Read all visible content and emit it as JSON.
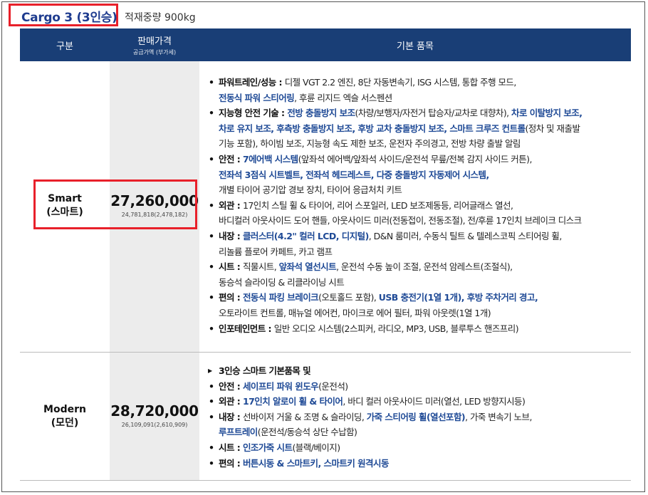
{
  "title": {
    "label": "Cargo 3 (3인승)",
    "payload": "적재중량 900kg"
  },
  "header": {
    "gubun": "구분",
    "price": "판매가격",
    "price_sub": "공급가액 (부가세)",
    "basic": "기본 품목"
  },
  "trims": [
    {
      "name": "Smart",
      "name_ko": "(스마트)",
      "price": "27,260,000",
      "price_sub": "24,781,818(2,478,182)"
    },
    {
      "name": "Modern",
      "name_ko": "(모던)",
      "price": "28,720,000",
      "price_sub": "26,109,091(2,610,909)"
    }
  ],
  "smart_features": [
    {
      "cat": "파워트레인/성능 : ",
      "lines": [
        [
          {
            "t": "디젤 VGT 2.2 엔진, 8단 자동변속기, ISG 시스템, 통합 주행 모드,"
          }
        ],
        [
          {
            "t": "전동식 파워 스티어링",
            "h": true
          },
          {
            "t": ", 후륜 리지드 엑슬 서스펜션"
          }
        ]
      ]
    },
    {
      "cat": "지능형 안전 기술 : ",
      "lines": [
        [
          {
            "t": "전방 충돌방지 보조",
            "h": true
          },
          {
            "t": "(차량/보행자/자전거 탑승자/교차로 대향차), "
          },
          {
            "t": "차로 이탈방지 보조,",
            "h": true
          }
        ],
        [
          {
            "t": "차로 유지 보조, 후측방 충돌방지 보조, 후방 교차 충돌방지 보조, 스마트 크루즈 컨트롤",
            "h": true
          },
          {
            "t": "(정차 및 재출발"
          }
        ],
        [
          {
            "t": "기능 포함), 하이빔 보조, 지능형 속도 제한 보조, 운전자 주의경고, 전방 차량 출발 알림"
          }
        ]
      ]
    },
    {
      "cat": "안전 : ",
      "lines": [
        [
          {
            "t": "7에어백 시스템",
            "h": true
          },
          {
            "t": "(앞좌석 에어백/앞좌석 사이드/운전석 무릎/전복 감지 사이드 커튼),"
          }
        ],
        [
          {
            "t": "전좌석 3점식 시트벨트, 전좌석 헤드레스트, 다중 충돌방지 자동제어 시스템,",
            "h": true
          }
        ],
        [
          {
            "t": "개별 타이어 공기압 경보 장치, 타이어 응급처치 키트"
          }
        ]
      ]
    },
    {
      "cat": "외관 : ",
      "lines": [
        [
          {
            "t": "17인치 스틸 휠 & 타이어, 리어 스포일러, LED 보조제동등, 리어글래스 열선,"
          }
        ],
        [
          {
            "t": "바디컬러 아웃사이드 도어 핸들, 아웃사이드 미러(전동접이, 전동조절), 전/후륜 17인치 브레이크 디스크"
          }
        ]
      ]
    },
    {
      "cat": "내장 : ",
      "lines": [
        [
          {
            "t": "클러스터(4.2\" 컬러 LCD, 디지털)",
            "h": true
          },
          {
            "t": ", D&N 룸미러, 수동식 틸트 & 텔레스코픽 스티어링 휠,"
          }
        ],
        [
          {
            "t": "리놀륨 플로어 카페트, 카고 램프"
          }
        ]
      ]
    },
    {
      "cat": "시트 : ",
      "lines": [
        [
          {
            "t": "직물시트, "
          },
          {
            "t": "앞좌석 열선시트",
            "h": true
          },
          {
            "t": ", 운전석 수동 높이 조절, 운전석 암레스트(조절식),"
          }
        ],
        [
          {
            "t": "동승석 슬라이딩 & 리클라이닝 시트"
          }
        ]
      ]
    },
    {
      "cat": "편의 : ",
      "lines": [
        [
          {
            "t": "전동식 파킹 브레이크",
            "h": true
          },
          {
            "t": "(오토홀드 포함), "
          },
          {
            "t": "USB 충전기(1열 1개), 후방 주차거리 경고,",
            "h": true
          }
        ],
        [
          {
            "t": "오토라이트 컨트롤, 매뉴얼 에어컨, 마이크로 에어 필터, 파워 아웃렛(1열 1개)"
          }
        ]
      ]
    },
    {
      "cat": "인포테인먼트 : ",
      "lines": [
        [
          {
            "t": "일반 오디오 시스템(2스피커, 라디오, MP3, USB, 블루투스 핸즈프리)"
          }
        ]
      ]
    }
  ],
  "modern_features": [
    {
      "arrow": true,
      "cat": "3인승 스마트 기본품목 및",
      "lines": [
        []
      ]
    },
    {
      "cat": "안전 : ",
      "lines": [
        [
          {
            "t": "세이프티 파워 윈도우",
            "h": true
          },
          {
            "t": "(운전석)"
          }
        ]
      ]
    },
    {
      "cat": "외관 : ",
      "lines": [
        [
          {
            "t": "17인치 알로이 휠 & 타이어",
            "h": true
          },
          {
            "t": ", 바디 컬러 아웃사이드 미러(열선, LED 방향지시등)"
          }
        ]
      ]
    },
    {
      "cat": "내장 : ",
      "lines": [
        [
          {
            "t": "선바이저 거울 & 조명 & 슬라이딩, "
          },
          {
            "t": "가죽 스티어링 휠(열선포함)",
            "h": true
          },
          {
            "t": ", 가죽 변속기 노브,"
          }
        ],
        [
          {
            "t": "루프트레이",
            "h": true
          },
          {
            "t": "(운전석/동승석 상단 수납함)"
          }
        ]
      ]
    },
    {
      "cat": "시트 : ",
      "lines": [
        [
          {
            "t": "인조가죽 시트",
            "h": true
          },
          {
            "t": "(블랙/베이지)"
          }
        ]
      ]
    },
    {
      "cat": "편의 : ",
      "lines": [
        [
          {
            "t": "버튼시동 & 스마트키, 스마트키 원격시동",
            "h": true
          }
        ]
      ]
    }
  ]
}
